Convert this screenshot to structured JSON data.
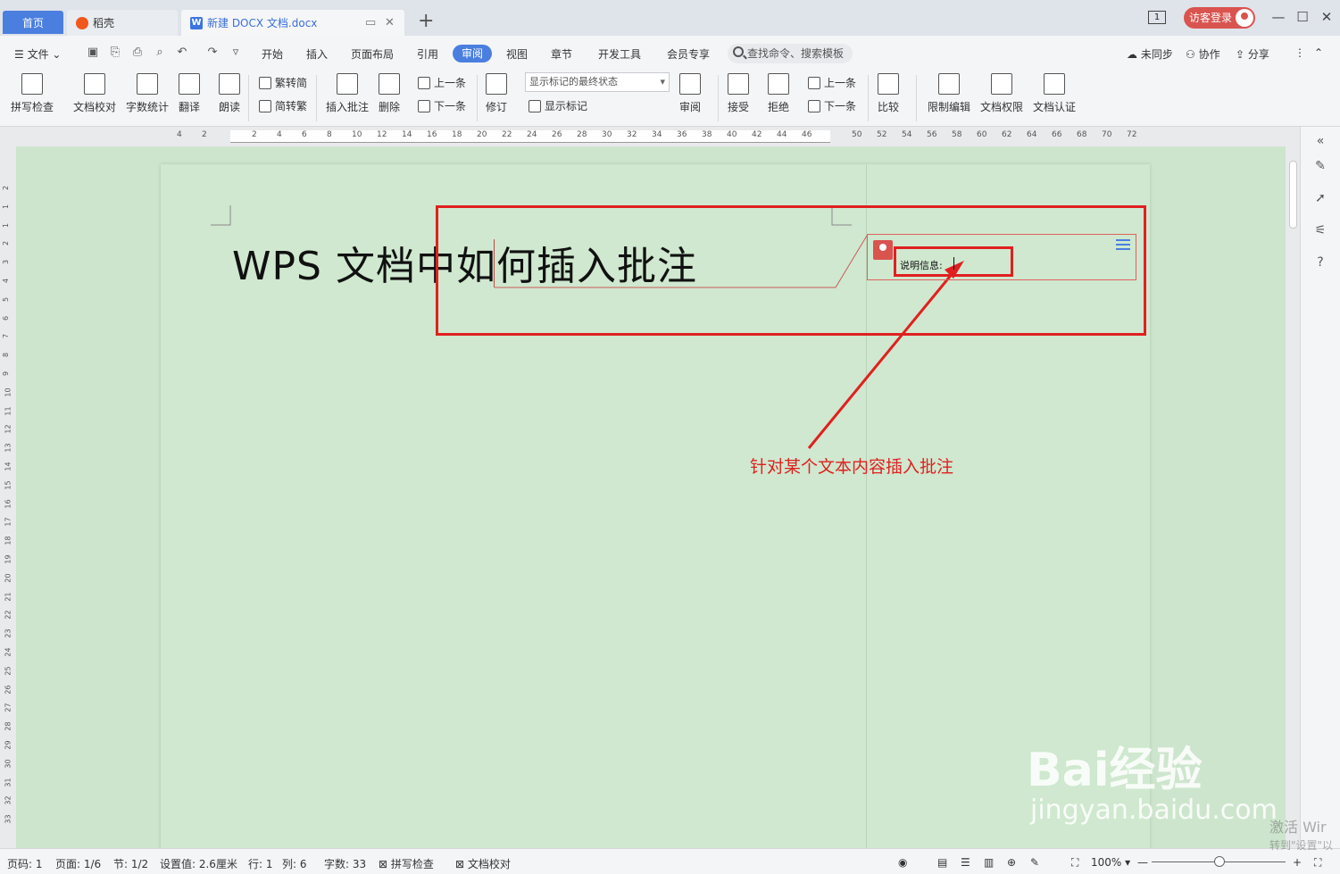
{
  "tabs": {
    "home": "首页",
    "daoke": "稻壳",
    "document": "新建 DOCX 文档.docx",
    "window_count": "1",
    "visitor_login": "访客登录"
  },
  "menu": {
    "file": "文件",
    "items": [
      "开始",
      "插入",
      "页面布局",
      "引用",
      "审阅",
      "视图",
      "章节",
      "开发工具",
      "会员专享"
    ],
    "active": "审阅",
    "search": "查找命令、搜索模板",
    "not_synced": "未同步",
    "collaborate": "协作",
    "share": "分享"
  },
  "ribbon": {
    "spell_check": "拼写检查",
    "doc_proof": "文档校对",
    "word_count": "字数统计",
    "translate": "翻译",
    "read_aloud": "朗读",
    "trad_to_simp": "繁转简",
    "simp_to_trad": "简转繁",
    "insert_comment": "插入批注",
    "delete": "删除",
    "prev": "上一条",
    "next": "下一条",
    "track_changes": "修订",
    "markup_state": "显示标记的最终状态",
    "show_markup": "显示标记",
    "review": "审阅",
    "accept": "接受",
    "reject": "拒绝",
    "prev2": "上一条",
    "next2": "下一条",
    "compare": "比较",
    "restrict_edit": "限制编辑",
    "doc_permission": "文档权限",
    "doc_certify": "文档认证"
  },
  "ruler": {
    "left_ticks": [
      "4",
      "2"
    ],
    "ticks": [
      "2",
      "4",
      "6",
      "8",
      "10",
      "12",
      "14",
      "16",
      "18",
      "20",
      "22",
      "24",
      "26",
      "28",
      "30",
      "32",
      "34",
      "36",
      "38",
      "40",
      "42",
      "44",
      "46",
      "50",
      "52",
      "54",
      "56",
      "58",
      "60",
      "62",
      "64",
      "66",
      "68",
      "70",
      "72"
    ],
    "vticks": [
      "2",
      "1",
      "1",
      "2",
      "3",
      "4",
      "5",
      "6",
      "7",
      "8",
      "9",
      "10",
      "11",
      "12",
      "13",
      "14",
      "15",
      "16",
      "17",
      "18",
      "19",
      "20",
      "21",
      "22",
      "23",
      "24",
      "25",
      "26",
      "27",
      "28",
      "29",
      "30",
      "31",
      "32",
      "33"
    ]
  },
  "document": {
    "title": "WPS 文档中如何插入批注",
    "comment_label": "说明信息:",
    "annotation": "针对某个文本内容插入批注"
  },
  "colors": {
    "accent": "#4a7fe0",
    "annotation_red": "#e02020",
    "canvas_green": "#cde5cd"
  },
  "status": {
    "page_code": "页码: 1",
    "pages": "页面: 1/6",
    "section": "节: 1/2",
    "setting": "设置值: 2.6厘米",
    "row": "行: 1",
    "col": "列: 6",
    "words": "字数: 33",
    "spell_check": "拼写检查",
    "doc_proof": "文档校对",
    "zoom": "100%"
  },
  "watermark": {
    "logo": "Bai经验",
    "url": "jingyan.baidu.com",
    "activate": "激活 Wir",
    "activate_sub": "转到\"设置\"以"
  }
}
